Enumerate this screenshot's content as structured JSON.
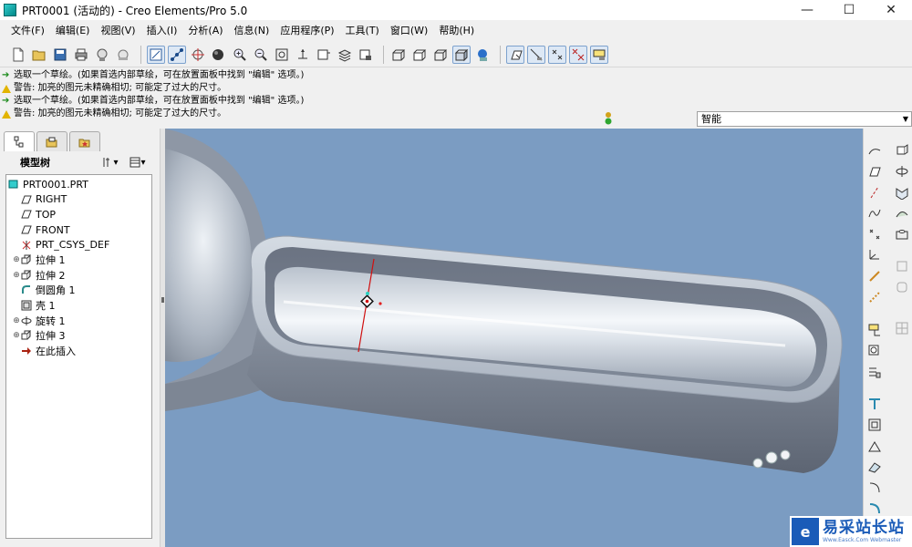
{
  "window": {
    "title": "PRT0001 (活动的) - Creo Elements/Pro 5.0",
    "minimize_glyph": "—",
    "maximize_glyph": "☐",
    "close_glyph": "✕"
  },
  "menu": [
    "文件(F)",
    "编辑(E)",
    "视图(V)",
    "插入(I)",
    "分析(A)",
    "信息(N)",
    "应用程序(P)",
    "工具(T)",
    "窗口(W)",
    "帮助(H)"
  ],
  "toolbar_icons": [
    "new-file-icon",
    "open-folder-icon",
    "save-icon",
    "print-icon",
    "send-mail-icon",
    "undo-icon",
    "zoom-box-icon",
    "select-mode-icon",
    "spin-center-icon",
    "shade-sphere-icon",
    "zoom-in-icon",
    "zoom-out-icon",
    "refit-icon",
    "orient-icon",
    "view-manager-icon",
    "layers-icon",
    "wireframe-icon",
    "hidden-line-icon",
    "no-hidden-icon",
    "shading-icon",
    "appearance-icon",
    "datum-plane-display-icon",
    "datum-axis-display-icon",
    "datum-point-display-icon",
    "csys-display-icon",
    "annotation-display-icon"
  ],
  "messages": [
    {
      "type": "prompt",
      "text": "选取一个草绘。(如果首选内部草绘，可在放置面板中找到 \"编辑\" 选项。)"
    },
    {
      "type": "warning",
      "text": "警告: 加亮的图元未精确相切; 可能定了过大的尺寸。"
    },
    {
      "type": "prompt",
      "text": "选取一个草绘。(如果首选内部草绘，可在放置面板中找到 \"编辑\" 选项。)"
    },
    {
      "type": "warning",
      "text": "警告: 加亮的图元未精确相切; 可能定了过大的尺寸。"
    }
  ],
  "filter": {
    "value": "智能"
  },
  "model_tree": {
    "header": "模型树",
    "nodes": [
      {
        "label": "PRT0001.PRT",
        "icon": "part-icon",
        "indent": 0,
        "expandable": false
      },
      {
        "label": "RIGHT",
        "icon": "datum-plane-icon",
        "indent": 1,
        "expandable": false
      },
      {
        "label": "TOP",
        "icon": "datum-plane-icon",
        "indent": 1,
        "expandable": false
      },
      {
        "label": "FRONT",
        "icon": "datum-plane-icon",
        "indent": 1,
        "expandable": false
      },
      {
        "label": "PRT_CSYS_DEF",
        "icon": "csys-icon",
        "indent": 1,
        "expandable": false
      },
      {
        "label": "拉伸 1",
        "icon": "extrude-icon",
        "indent": 1,
        "expandable": true
      },
      {
        "label": "拉伸 2",
        "icon": "extrude-icon",
        "indent": 1,
        "expandable": true
      },
      {
        "label": "倒圆角 1",
        "icon": "round-icon",
        "indent": 1,
        "expandable": false
      },
      {
        "label": "壳 1",
        "icon": "shell-icon",
        "indent": 1,
        "expandable": false
      },
      {
        "label": "旋转 1",
        "icon": "revolve-icon",
        "indent": 1,
        "expandable": true
      },
      {
        "label": "拉伸 3",
        "icon": "extrude-icon",
        "indent": 1,
        "expandable": true
      },
      {
        "label": "在此插入",
        "icon": "insert-here-icon",
        "indent": 1,
        "expandable": false
      }
    ]
  },
  "watermark": {
    "logo": "e",
    "main": "易采站长站",
    "sub": "Www.Easck.Com Webmaster"
  },
  "colors": {
    "viewport_bg": "#7b9cc2",
    "part_body": "#b4bdc9",
    "part_shadow": "#6e7684",
    "selection_red": "#d01010",
    "accent_blue": "#1a5bb8"
  }
}
